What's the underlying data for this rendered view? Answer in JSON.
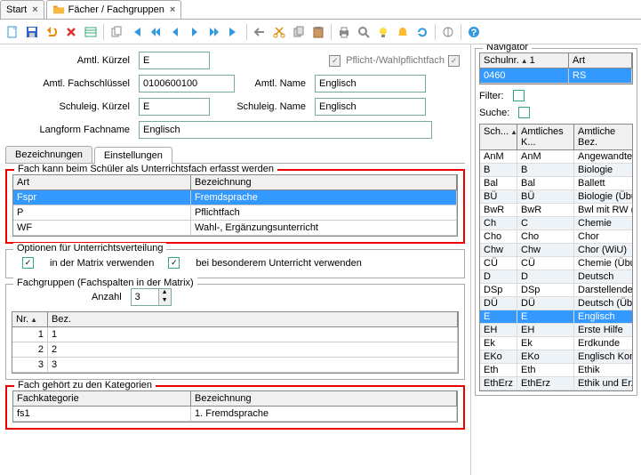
{
  "tabs_top": {
    "start": "Start",
    "faecher": "Fächer / Fachgruppen"
  },
  "form": {
    "amtl_kuerzel_label": "Amtl. Kürzel",
    "amtl_kuerzel": "E",
    "pflicht_label": "Pflicht-/Wahlpflichtfach",
    "amtl_fachschluessel_label": "Amtl. Fachschlüssel",
    "amtl_fachschluessel": "0100600100",
    "amtl_name_label": "Amtl. Name",
    "amtl_name": "Englisch",
    "schuleig_kuerzel_label": "Schuleig. Kürzel",
    "schuleig_kuerzel": "E",
    "schuleig_name_label": "Schuleig. Name",
    "schuleig_name": "Englisch",
    "langform_label": "Langform Fachname",
    "langform": "Englisch"
  },
  "subtabs": {
    "bezeichnungen": "Bezeichnungen",
    "einstellungen": "Einstellungen"
  },
  "fieldset1": {
    "legend": "Fach kann beim Schüler als Unterrichtsfach erfasst werden",
    "headers": {
      "art": "Art",
      "bez": "Bezeichnung"
    },
    "rows": [
      {
        "art": "Fspr",
        "bez": "Fremdsprache"
      },
      {
        "art": "P",
        "bez": "Pflichtfach"
      },
      {
        "art": "WF",
        "bez": "Wahl-, Ergänzungsunterricht"
      }
    ]
  },
  "fieldset2": {
    "legend": "Optionen für Unterrichtsverteilung",
    "opt1": "in der Matrix verwenden",
    "opt2": "bei besonderem Unterricht verwenden"
  },
  "fieldset3": {
    "legend": "Fachgruppen (Fachspalten in der Matrix)",
    "anzahl_label": "Anzahl",
    "anzahl": "3",
    "headers": {
      "nr": "Nr.",
      "bez": "Bez."
    },
    "rows": [
      {
        "nr": "1",
        "bez": "1"
      },
      {
        "nr": "2",
        "bez": "2"
      },
      {
        "nr": "3",
        "bez": "3"
      }
    ]
  },
  "fieldset4": {
    "legend": "Fach gehört zu den Kategorien",
    "headers": {
      "kat": "Fachkategorie",
      "bez": "Bezeichnung"
    },
    "rows": [
      {
        "kat": "fs1",
        "bez": "1. Fremdsprache"
      }
    ]
  },
  "navigator": {
    "title": "Navigator",
    "headers": {
      "schulnr": "Schulnr.",
      "art": "Art"
    },
    "row": {
      "schulnr": "0460",
      "art": "RS"
    },
    "filter_label": "Filter:",
    "suche_label": "Suche:",
    "list_headers": {
      "c1": "Sch...",
      "c2": "Amtliches K...",
      "c3": "Amtliche Bez."
    },
    "list": [
      {
        "c1": "AnM",
        "c2": "AnM",
        "c3": "Angewandte M"
      },
      {
        "c1": "B",
        "c2": "B",
        "c3": "Biologie"
      },
      {
        "c1": "Bal",
        "c2": "Bal",
        "c3": "Ballett"
      },
      {
        "c1": "BÜ",
        "c2": "BÜ",
        "c3": "Biologie (Übung"
      },
      {
        "c1": "BwR",
        "c2": "BwR",
        "c3": "Bwl mit RW (ink"
      },
      {
        "c1": "Ch",
        "c2": "C",
        "c3": "Chemie"
      },
      {
        "c1": "Cho",
        "c2": "Cho",
        "c3": "Chor"
      },
      {
        "c1": "Chw",
        "c2": "Chw",
        "c3": "Chor (WiU)"
      },
      {
        "c1": "CÜ",
        "c2": "CÜ",
        "c3": "Chemie (Übung"
      },
      {
        "c1": "D",
        "c2": "D",
        "c3": "Deutsch"
      },
      {
        "c1": "DSp",
        "c2": "DSp",
        "c3": "Darstellendes S"
      },
      {
        "c1": "DÜ",
        "c2": "DÜ",
        "c3": "Deutsch (Übun"
      },
      {
        "c1": "E",
        "c2": "E",
        "c3": "Englisch"
      },
      {
        "c1": "EH",
        "c2": "EH",
        "c3": "Erste Hilfe"
      },
      {
        "c1": "Ek",
        "c2": "Ek",
        "c3": "Erdkunde"
      },
      {
        "c1": "EKo",
        "c2": "EKo",
        "c3": "Englisch Konve"
      },
      {
        "c1": "Eth",
        "c2": "Eth",
        "c3": "Ethik"
      },
      {
        "c1": "EthErz",
        "c2": "EthErz",
        "c3": "Ethik und Erzie"
      }
    ],
    "selected_index": 12,
    "one": "1"
  }
}
